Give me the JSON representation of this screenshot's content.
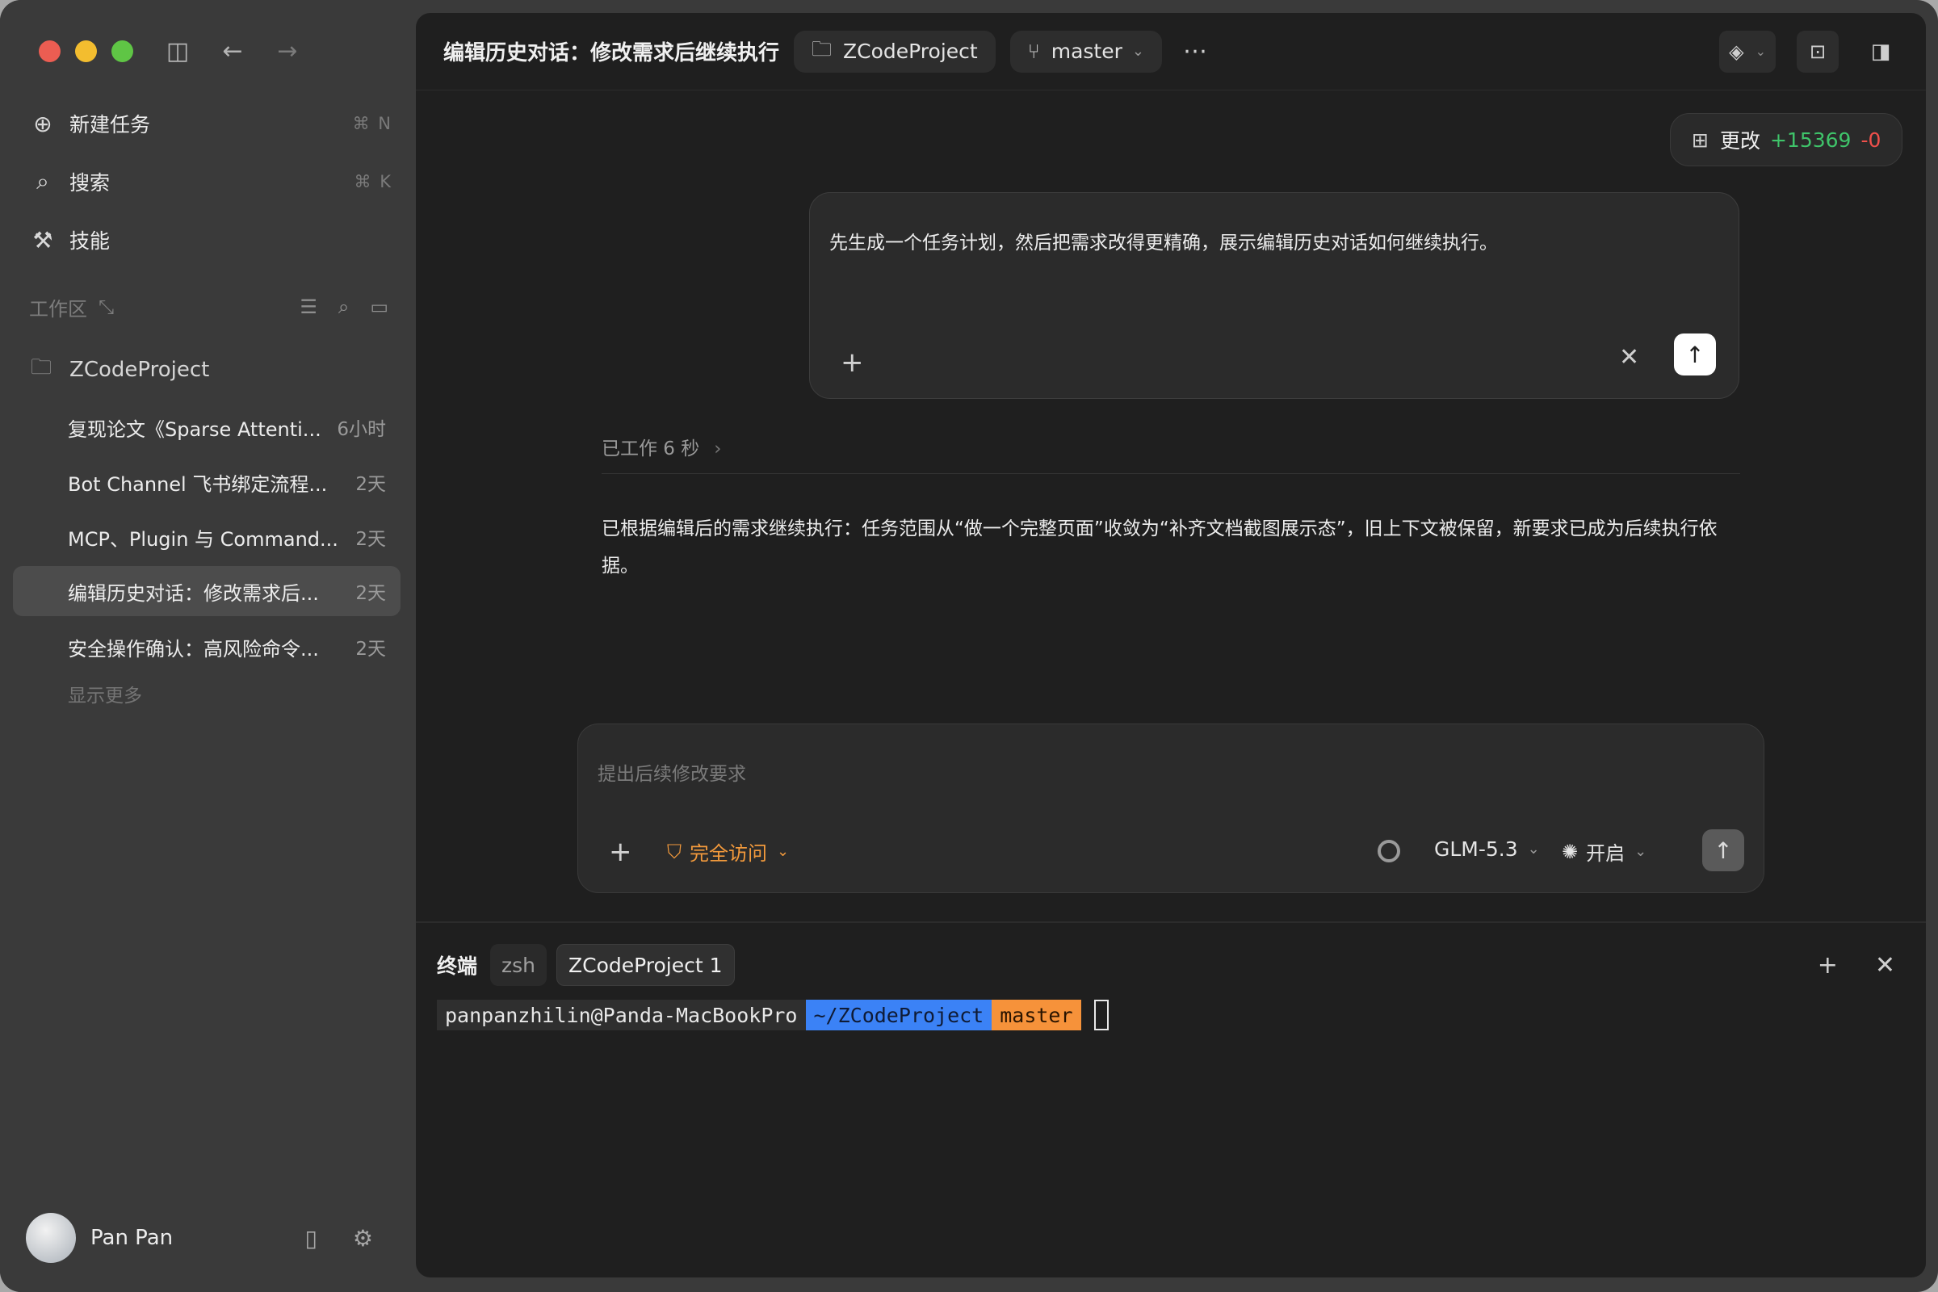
{
  "sidebar": {
    "nav": [
      {
        "label": "新建任务",
        "shortcut": "⌘ N",
        "icon": "plus-circle-icon"
      },
      {
        "label": "搜索",
        "shortcut": "⌘ K",
        "icon": "search-icon"
      },
      {
        "label": "技能",
        "shortcut": "",
        "icon": "wand-icon"
      }
    ],
    "workspace_label": "工作区",
    "project_name": "ZCodeProject",
    "threads": [
      {
        "title": "复现论文《Sparse Attenti...",
        "time": "6小时"
      },
      {
        "title": "Bot Channel 飞书绑定流程...",
        "time": "2天"
      },
      {
        "title": "MCP、Plugin 与 Command...",
        "time": "2天"
      },
      {
        "title": "编辑历史对话：修改需求后...",
        "time": "2天"
      },
      {
        "title": "安全操作确认：高风险命令...",
        "time": "2天"
      }
    ],
    "show_more": "显示更多",
    "user_name": "Pan Pan"
  },
  "topbar": {
    "title": "编辑历史对话：修改需求后继续执行",
    "project": "ZCodeProject",
    "branch": "master"
  },
  "changes": {
    "label": "更改",
    "added": "+15369",
    "removed": "-0"
  },
  "edit_message": {
    "text": "先生成一个任务计划，然后把需求改得更精确，展示编辑历史对话如何继续执行。"
  },
  "worked": "已工作 6 秒",
  "response": "已根据编辑后的需求继续执行：任务范围从“做一个完整页面”收敛为“补齐文档截图展示态”，旧上下文被保留，新要求已成为后续执行依据。",
  "composer": {
    "placeholder": "提出后续修改要求",
    "access": "完全访问",
    "model": "GLM-5.3",
    "thinking": "开启"
  },
  "terminal": {
    "label": "终端",
    "tabs": [
      "zsh",
      "ZCodeProject 1"
    ],
    "prompt_user": "panpanzhilin@Panda-MacBookPro",
    "prompt_dir": " ~/ZCodeProject",
    "prompt_branch": " master"
  },
  "colors": {
    "accent_add": "#3fc46a",
    "accent_del": "#f0504b",
    "access": "#f39a3c",
    "dir_bg": "#3b82f6",
    "branch_bg": "#f6923a"
  }
}
